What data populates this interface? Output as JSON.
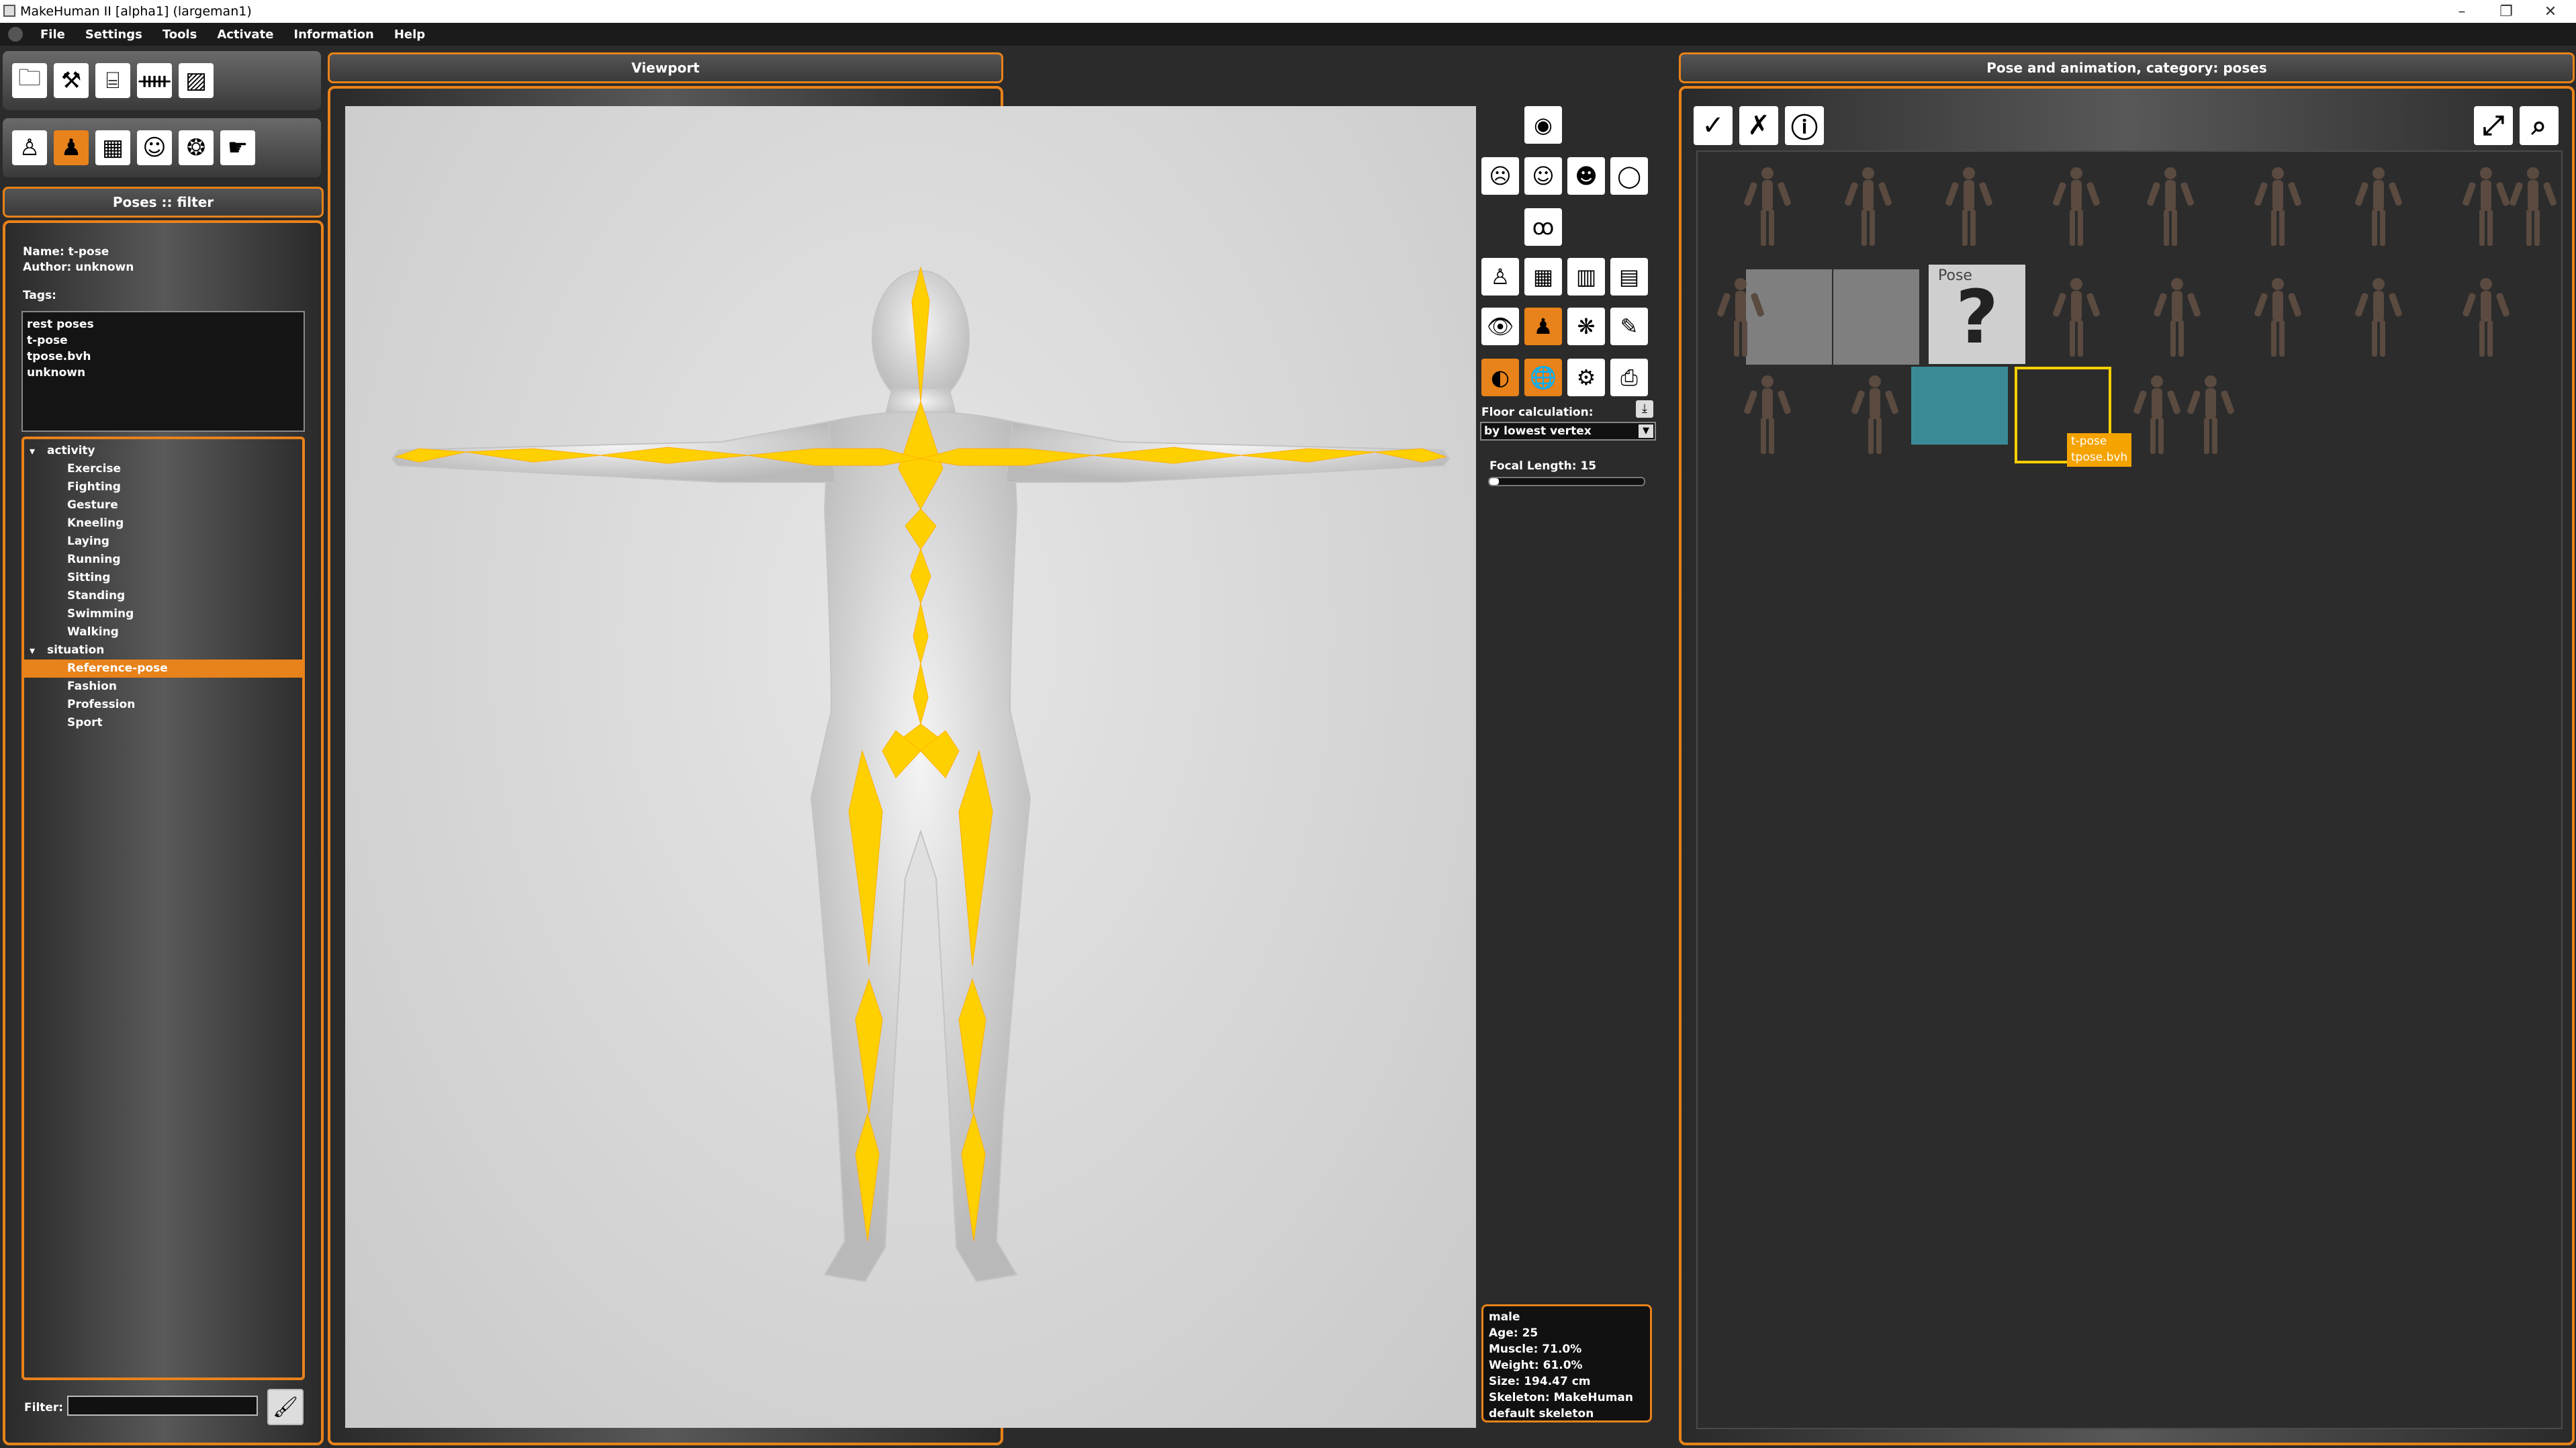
{
  "window": {
    "title": "MakeHuman II [alpha1]  (largeman1)"
  },
  "menu": [
    "File",
    "Settings",
    "Tools",
    "Activate",
    "Information",
    "Help"
  ],
  "headers": {
    "left": "Poses :: filter",
    "viewport": "Viewport",
    "right": "Pose and animation, category: poses"
  },
  "info": {
    "name": "Name: t-pose",
    "author": "Author: unknown",
    "tags_label": "Tags:"
  },
  "tags": [
    "rest poses",
    "t-pose",
    "tpose.bvh",
    "unknown"
  ],
  "tree": [
    {
      "label": "activity",
      "children": [
        "Exercise",
        "Fighting",
        "Gesture",
        "Kneeling",
        "Laying",
        "Running",
        "Sitting",
        "Standing",
        "Swimming",
        "Walking"
      ]
    },
    {
      "label": "situation",
      "children": [
        "Reference-pose",
        "Fashion",
        "Profession",
        "Sport"
      ]
    }
  ],
  "selected_tree_item": "Reference-pose",
  "filter": {
    "label": "Filter:",
    "value": ""
  },
  "viewport": {
    "floor_label": "Floor calculation:",
    "floor_value": "by lowest vertex",
    "focal_label": "Focal Length: 15",
    "focal_fraction": 0.06
  },
  "stats": [
    "male",
    "Age: 25",
    "Muscle: 71.0%",
    "Weight: 61.0%",
    "Size: 194.47 cm",
    "Skeleton: MakeHuman",
    "default skeleton"
  ],
  "placeholder_text": {
    "title": "Pose",
    "mark": "?"
  },
  "tooltip": [
    "t-pose",
    "tpose.bvh"
  ],
  "colors": {
    "accent": "#e8821a",
    "bone": "#ffd000",
    "tooltip": "#f5a300"
  }
}
